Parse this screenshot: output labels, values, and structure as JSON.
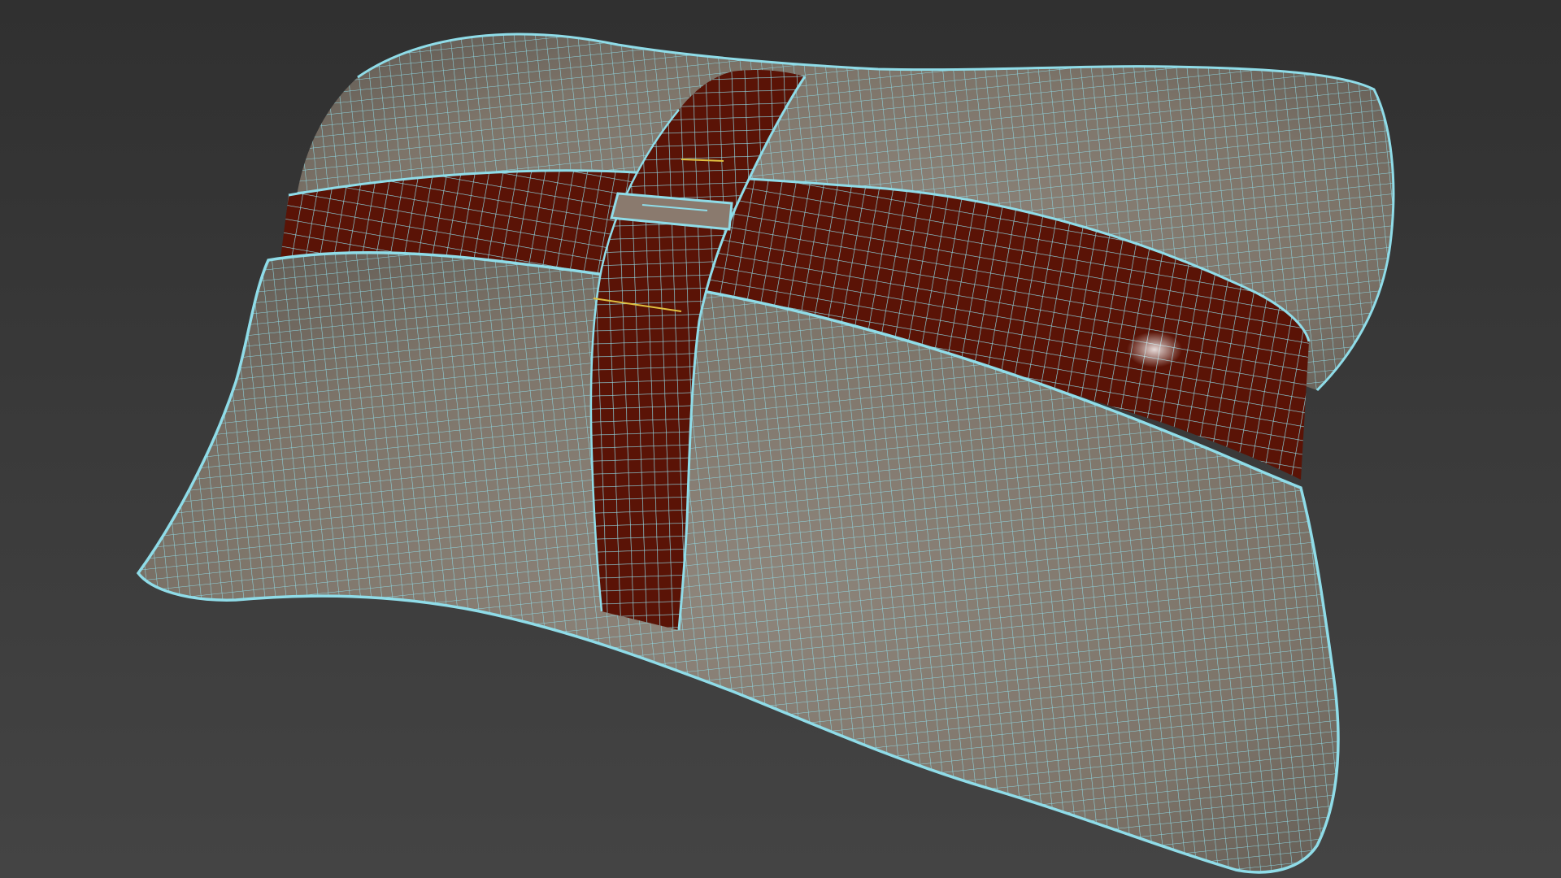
{
  "viewport": {
    "background_top": "#303030",
    "background_bottom": "#444444"
  },
  "model": {
    "name": "",
    "display_mode": "shaded-with-wireframe",
    "parts": [
      {
        "part": "pillow-body",
        "fill": "#857c72",
        "wire": "#8fdce8"
      },
      {
        "part": "strap",
        "fill": "#5a1306",
        "wire": "#8fdce8"
      },
      {
        "part": "buckle",
        "fill": "#8a7a6e",
        "wire": "#8fdce8"
      }
    ],
    "selected_edge_color": "#e0c040"
  }
}
